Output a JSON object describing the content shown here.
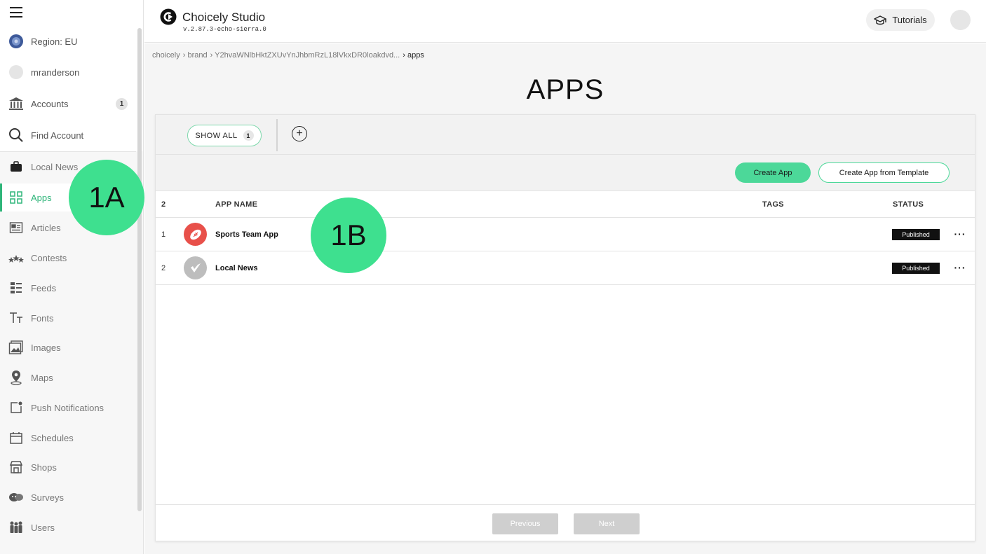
{
  "sidebar": {
    "top_items": [
      {
        "label": "Region: EU",
        "icon": "globe-icon"
      },
      {
        "label": "mranderson",
        "icon": "avatar-icon"
      },
      {
        "label": "Accounts",
        "icon": "bank-icon",
        "badge": "1"
      },
      {
        "label": "Find Account",
        "icon": "search-icon"
      }
    ],
    "items": [
      {
        "label": "Local News",
        "icon": "briefcase-icon"
      },
      {
        "label": "Apps",
        "icon": "grid-icon",
        "active": true
      },
      {
        "label": "Articles",
        "icon": "article-icon"
      },
      {
        "label": "Contests",
        "icon": "stars-icon"
      },
      {
        "label": "Feeds",
        "icon": "feed-icon"
      },
      {
        "label": "Fonts",
        "icon": "font-icon"
      },
      {
        "label": "Images",
        "icon": "image-icon"
      },
      {
        "label": "Maps",
        "icon": "map-pin-icon"
      },
      {
        "label": "Push Notifications",
        "icon": "notification-icon"
      },
      {
        "label": "Schedules",
        "icon": "calendar-icon"
      },
      {
        "label": "Shops",
        "icon": "shop-icon"
      },
      {
        "label": "Surveys",
        "icon": "survey-icon"
      },
      {
        "label": "Users",
        "icon": "users-icon"
      }
    ],
    "accent_color": "#2fb57a"
  },
  "header": {
    "title": "Choicely Studio",
    "version": "v.2.87.3-echo-sierra.0",
    "tutorials_label": "Tutorials"
  },
  "breadcrumb": [
    "choicely",
    "› brand",
    "› Y2hvaWNlbHktZXUvYnJhbmRzL18lVkxDR0loakdvd...",
    "› apps"
  ],
  "main": {
    "title": "APPS",
    "filters": {
      "show_all_label": "SHOW ALL",
      "show_all_count": "1",
      "add_label": "+"
    },
    "actions": {
      "create_label": "Create App",
      "template_label": "Create App from Template"
    },
    "table": {
      "count": "2",
      "columns": {
        "name": "APP NAME",
        "tags": "TAGS",
        "status": "STATUS"
      },
      "rows": [
        {
          "num": "1",
          "name": "Sports Team App",
          "status": "Published",
          "icon": "football-icon",
          "icon_color": "#e8504a"
        },
        {
          "num": "2",
          "name": "Local News",
          "status": "Published",
          "icon": "check-logo-icon",
          "icon_color": "#bdbdbd"
        }
      ],
      "more_label": "···"
    },
    "pager": {
      "prev": "Previous",
      "next": "Next"
    }
  },
  "callouts": {
    "a": "1A",
    "b": "1B"
  },
  "colors": {
    "primary": "#4cd899",
    "callout": "#3ee08f",
    "published_bg": "#111111"
  }
}
